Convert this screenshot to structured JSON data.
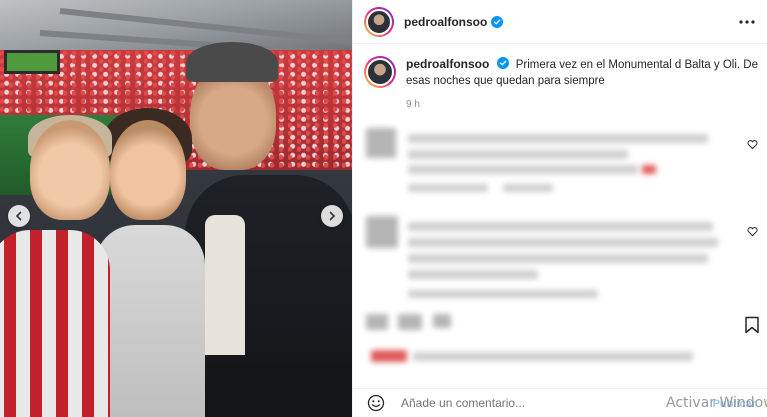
{
  "post": {
    "username": "pedroalfonsoo",
    "caption": "Primera vez en el Monumental d Balta y Oli. De esas noches que quedan para siempre",
    "time": "9 h"
  },
  "comment_box": {
    "placeholder": "Añade un comentario...",
    "publish_label": "Publicar"
  },
  "overlay": {
    "watermark": "Activar Windows"
  },
  "icons": {
    "verified": "verified-badge-icon",
    "more": "more-options-icon",
    "heart": "heart-icon",
    "bookmark": "bookmark-icon",
    "emoji": "emoji-icon",
    "prev": "chevron-left-icon",
    "next": "chevron-right-icon"
  },
  "colors": {
    "verified_blue": "#0095f6",
    "publish_blue": "#9ac9f3",
    "muted_text": "#8e8e8e"
  }
}
